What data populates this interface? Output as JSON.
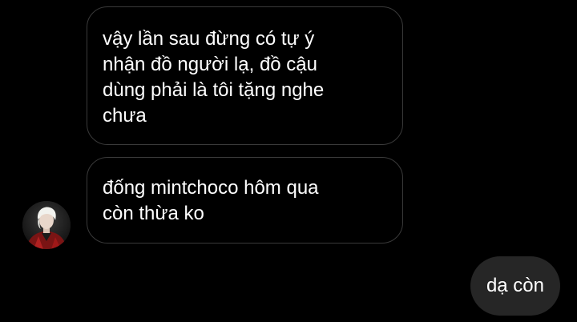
{
  "chat": {
    "messages": [
      {
        "sender": "other",
        "text": "vậy lần sau đừng có tự ý\nnhận đồ người lạ, đồ cậu\ndùng phải là tôi tặng nghe\nchưa"
      },
      {
        "sender": "other",
        "text": "đống mintchoco hôm qua\ncòn thừa ko"
      },
      {
        "sender": "me",
        "text": "dạ còn"
      }
    ],
    "avatar_icon": "user-avatar-photo"
  },
  "colors": {
    "background": "#000000",
    "incoming_border": "#3a3a3a",
    "outgoing_bubble": "#262626",
    "text": "#ffffff"
  }
}
